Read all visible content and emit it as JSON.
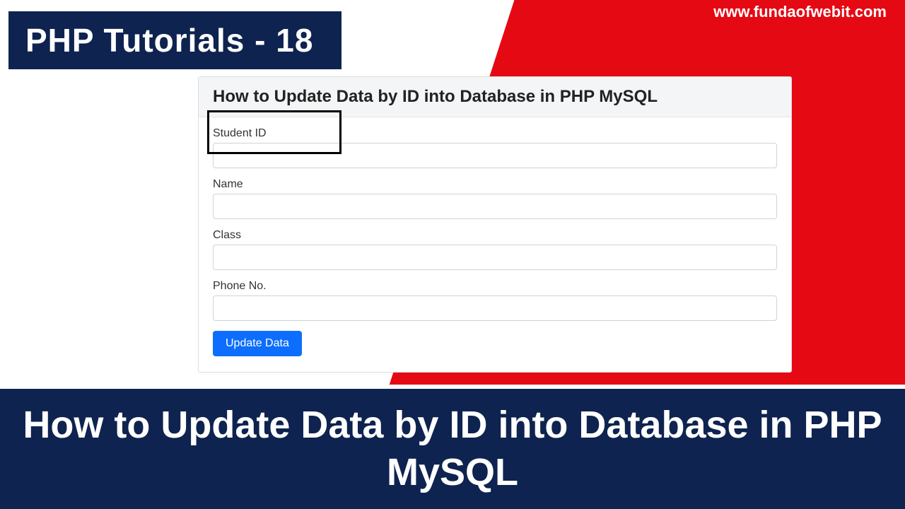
{
  "site_url": "www.fundaofwebit.com",
  "top_ribbon": "PHP Tutorials - 18",
  "card": {
    "title": "How to Update Data by ID into Database in PHP MySQL",
    "fields": {
      "student_id_label": "Student ID",
      "name_label": "Name",
      "class_label": "Class",
      "phone_label": "Phone No."
    },
    "button_label": "Update Data"
  },
  "bottom_title": "How to Update Data by ID into Database in PHP MySQL"
}
